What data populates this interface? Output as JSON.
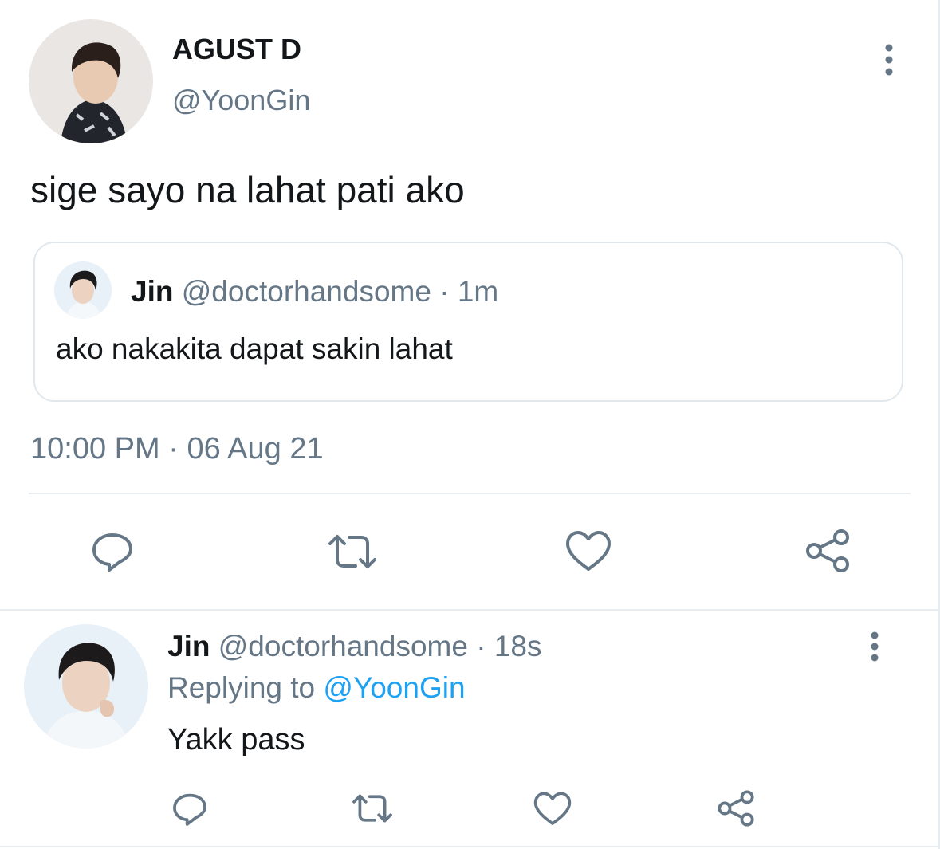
{
  "main_tweet": {
    "author_name": "AGUST D",
    "author_handle": "@YoonGin",
    "text": "sige sayo na lahat pati ako",
    "quoted": {
      "author_name": "Jin",
      "author_handle": "@doctorhandsome",
      "separator": "·",
      "age": "1m",
      "text": "ako nakakita dapat sakin lahat"
    },
    "time": "10:00 PM",
    "separator": "·",
    "date": "06 Aug 21"
  },
  "reply_tweet": {
    "author_name": "Jin",
    "author_handle": "@doctorhandsome",
    "separator": "·",
    "age": "18s",
    "replying_to_label": "Replying to",
    "replying_to_handle": "@YoonGin",
    "text": "Yakk pass"
  },
  "icons": {
    "reply": "speech-bubble-icon",
    "retweet": "retweet-icon",
    "like": "heart-icon",
    "share": "share-icon",
    "more": "vertical-ellipsis-icon"
  },
  "colors": {
    "text": "#14171a",
    "muted": "#657786",
    "link": "#1da1f2",
    "divider": "#e6ecf0"
  }
}
